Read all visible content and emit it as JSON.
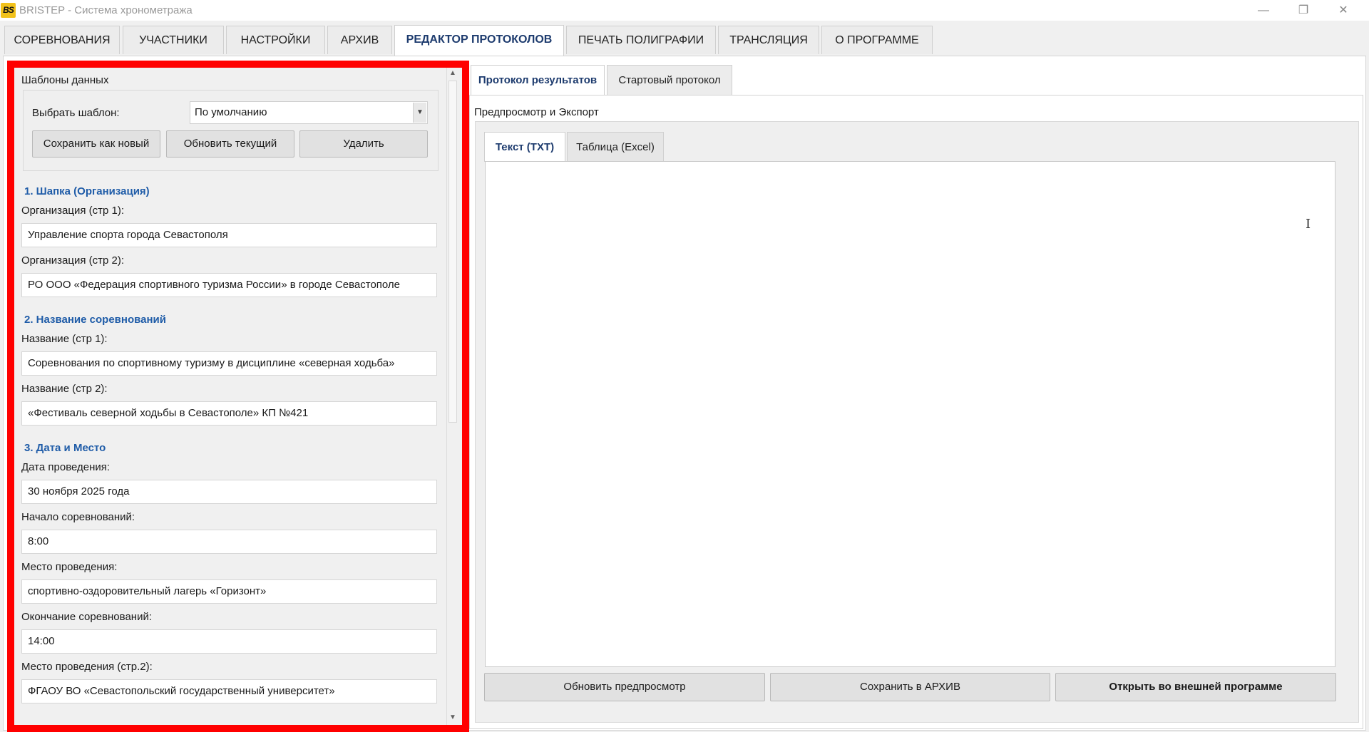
{
  "window": {
    "logo_text": "BS",
    "title": "BRISTEP - Система хронометража",
    "minimize_glyph": "—",
    "maximize_glyph": "❐",
    "close_glyph": "✕"
  },
  "main_tabs": [
    {
      "label": "СОРЕВНОВАНИЯ"
    },
    {
      "label": "УЧАСТНИКИ"
    },
    {
      "label": "НАСТРОЙКИ"
    },
    {
      "label": "АРХИВ"
    },
    {
      "label": "РЕДАКТОР ПРОТОКОЛОВ",
      "active": true
    },
    {
      "label": "ПЕЧАТЬ ПОЛИГРАФИИ"
    },
    {
      "label": "ТРАНСЛЯЦИЯ"
    },
    {
      "label": "О ПРОГРАММЕ"
    }
  ],
  "templates": {
    "group_title": "Шаблоны данных",
    "select_label": "Выбрать шаблон:",
    "selected": "По умолчанию",
    "save_new": "Сохранить как новый",
    "update_current": "Обновить текущий",
    "delete": "Удалить"
  },
  "sections": {
    "header": {
      "title": "1. Шапка (Организация)",
      "org1_label": "Организация (стр 1):",
      "org1_value": "Управление спорта города Севастополя",
      "org2_label": "Организация (стр 2):",
      "org2_value": "РО ООО «Федерация спортивного туризма России» в городе Севастополе"
    },
    "name": {
      "title": "2. Название соревнований",
      "name1_label": "Название (стр 1):",
      "name1_value": "Соревнования по спортивному туризму в дисциплине «северная ходьба»",
      "name2_label": "Название (стр 2):",
      "name2_value": "«Фестиваль северной ходьбы в Севастополе»  КП №421"
    },
    "date_place": {
      "title": "3. Дата и Место",
      "date_label": "Дата проведения:",
      "date_value": "30 ноября 2025 года",
      "start_label": "Начало соревнований:",
      "start_value": "8:00",
      "place_label": "Место проведения:",
      "place_value": "спортивно-оздоровительный лагерь «Горизонт»",
      "end_label": "Окончание соревнований:",
      "end_value": "14:00",
      "place2_label": "Место проведения (стр.2):",
      "place2_value": "ФГАОУ ВО «Севастопольский государственный университет»"
    }
  },
  "right": {
    "tabs": [
      {
        "label": "Протокол результатов",
        "active": true
      },
      {
        "label": "Стартовый протокол"
      }
    ],
    "group_title": "Предпросмотр и Экспорт",
    "inner_tabs": [
      {
        "label": "Текст (TXT)",
        "active": true
      },
      {
        "label": "Таблица (Excel)"
      }
    ],
    "refresh_button": "Обновить предпросмотр",
    "save_archive_button": "Сохранить в АРХИВ",
    "open_external_button": "Открыть во внешней программе",
    "cursor_glyph": "I"
  },
  "colors": {
    "highlight_border": "#ff0000",
    "section_heading": "#1f5ca8",
    "active_tab_text": "#1d3b6e"
  }
}
